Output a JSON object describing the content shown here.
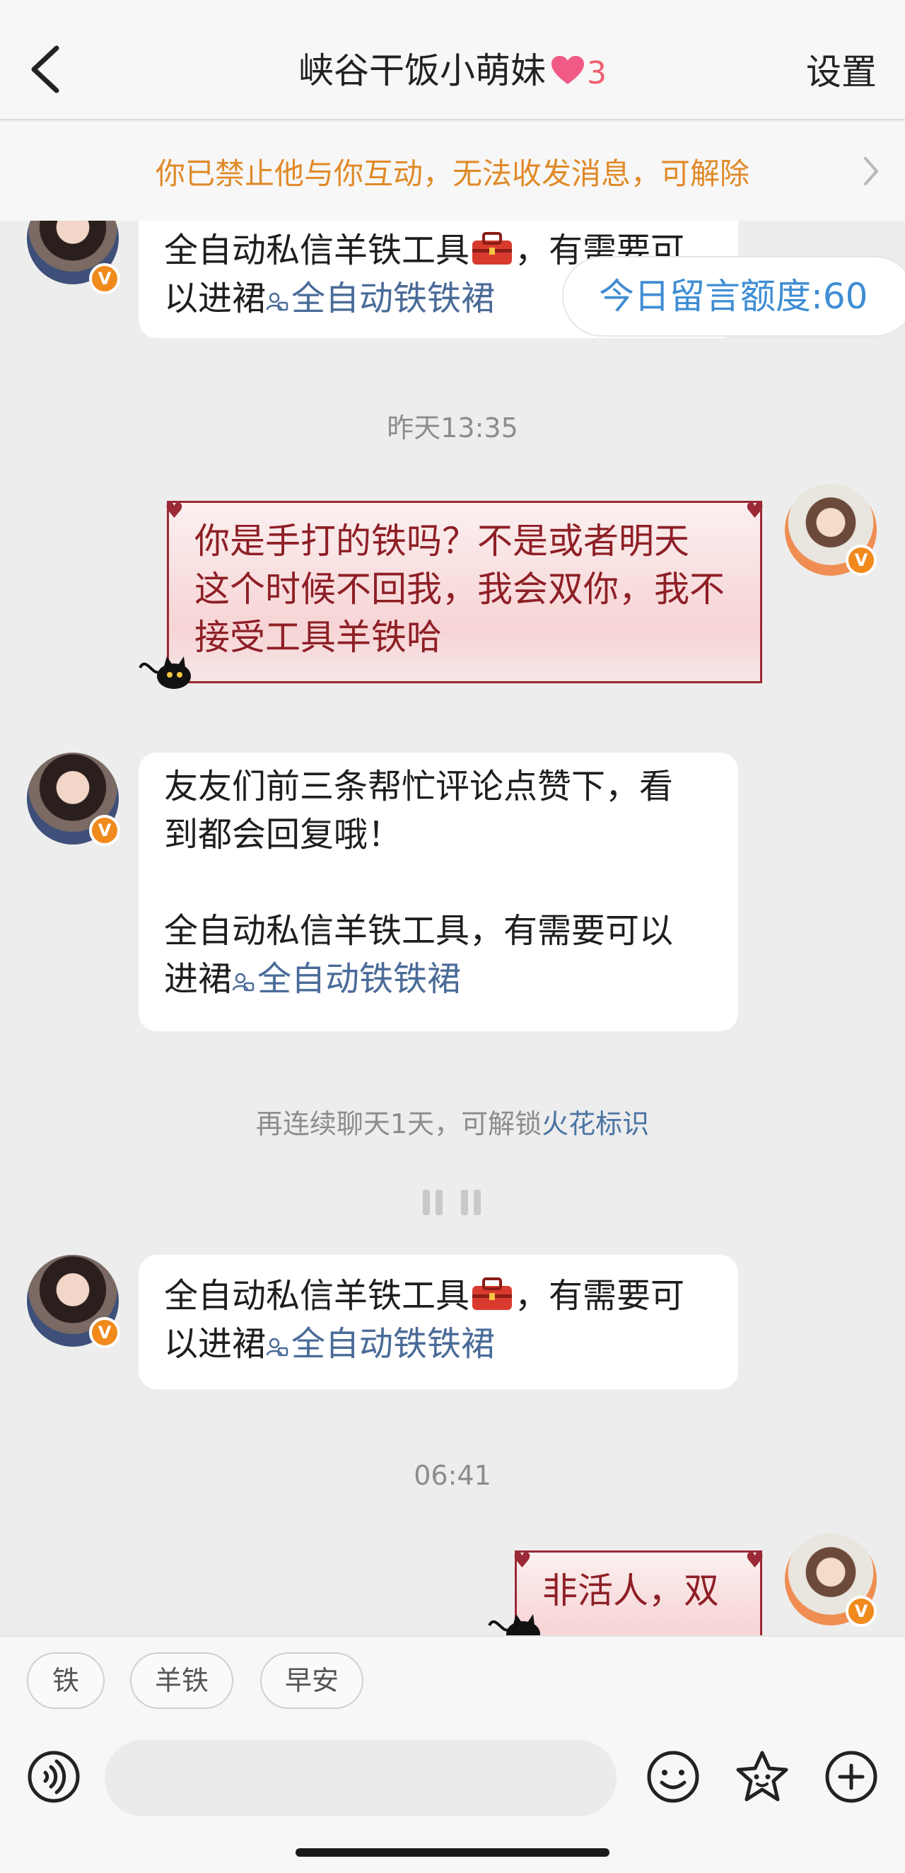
{
  "header": {
    "title": "峡谷干饭小萌妹",
    "heart_count": "3",
    "settings_label": "设置"
  },
  "banner": {
    "text": "你已禁止他与你互动，无法收发消息，可解除"
  },
  "quota": {
    "text": "今日留言额度:60"
  },
  "messages": [
    {
      "sender": "her",
      "line1": "全自动私信羊铁工具",
      "line1_tail": "，有需要可",
      "line2_prefix": "以进裙",
      "link": "全自动铁铁裙"
    },
    {
      "time": "昨天13:35"
    },
    {
      "sender": "me",
      "lines": [
        "你是手打的铁吗？不是或者明天",
        "这个时候不回我，我会双你，我不",
        "接受工具羊铁哈"
      ]
    },
    {
      "sender": "her",
      "lines": [
        "友友们前三条帮忙评论点赞下，看",
        "到都会回复哦！"
      ],
      "line3": "全自动私信羊铁工具，有需要可以",
      "line4_prefix": "进裙",
      "link": "全自动铁铁裙"
    },
    {
      "notice": "再连续聊天1天，可解锁",
      "notice_link": "火花标识"
    },
    {
      "sender": "her",
      "line1": "全自动私信羊铁工具",
      "line1_tail": "，有需要可",
      "line2_prefix": "以进裙",
      "link": "全自动铁铁裙"
    },
    {
      "time": "06:41"
    },
    {
      "sender": "me",
      "text": "非活人，双"
    }
  ],
  "quick_replies": [
    "铁",
    "羊铁",
    "早安"
  ],
  "icons": {
    "back": "chevron-left-icon",
    "heart": "heart-icon",
    "voice": "voice-icon",
    "emoji": "emoji-icon",
    "sticker": "sticker-icon",
    "plus": "plus-icon"
  },
  "colors": {
    "banner_text": "#e08a28",
    "quota_text": "#3f8dd4",
    "link": "#4a6b98",
    "love_text": "#8e1f26"
  }
}
